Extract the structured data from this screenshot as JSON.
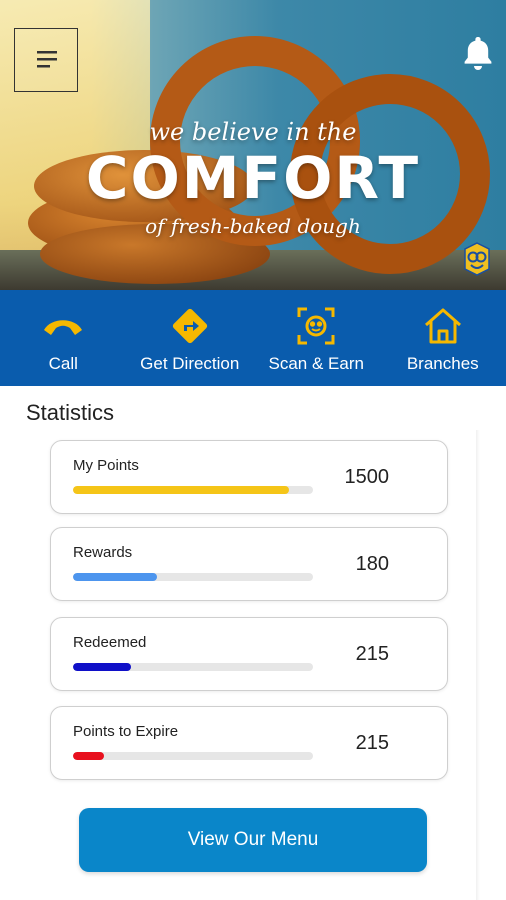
{
  "hero": {
    "line1": "we believe in the",
    "line2": "COMFORT",
    "line3": "of fresh-baked dough"
  },
  "header": {
    "menu_icon": "hamburger-icon",
    "notification_icon": "bell-icon"
  },
  "quick_actions": [
    {
      "label": "Call",
      "icon": "phone-icon"
    },
    {
      "label": "Get Direction",
      "icon": "direction-icon"
    },
    {
      "label": "Scan & Earn",
      "icon": "scan-icon"
    },
    {
      "label": "Branches",
      "icon": "home-icon"
    }
  ],
  "statistics": {
    "title": "Statistics",
    "items": [
      {
        "label": "My Points",
        "value": "1500",
        "progress": 0.9,
        "color": "#f5c518"
      },
      {
        "label": "Rewards",
        "value": "180",
        "progress": 0.35,
        "color": "#4d95ee"
      },
      {
        "label": "Redeemed",
        "value": "215",
        "progress": 0.24,
        "color": "#1010c8"
      },
      {
        "label": "Points to Expire",
        "value": "215",
        "progress": 0.13,
        "color": "#e8101e"
      }
    ]
  },
  "cta": {
    "label": "View Our Menu"
  },
  "colors": {
    "brand_blue": "#0a5cad",
    "icon_yellow": "#f5b800",
    "button_blue": "#0a86c9"
  }
}
